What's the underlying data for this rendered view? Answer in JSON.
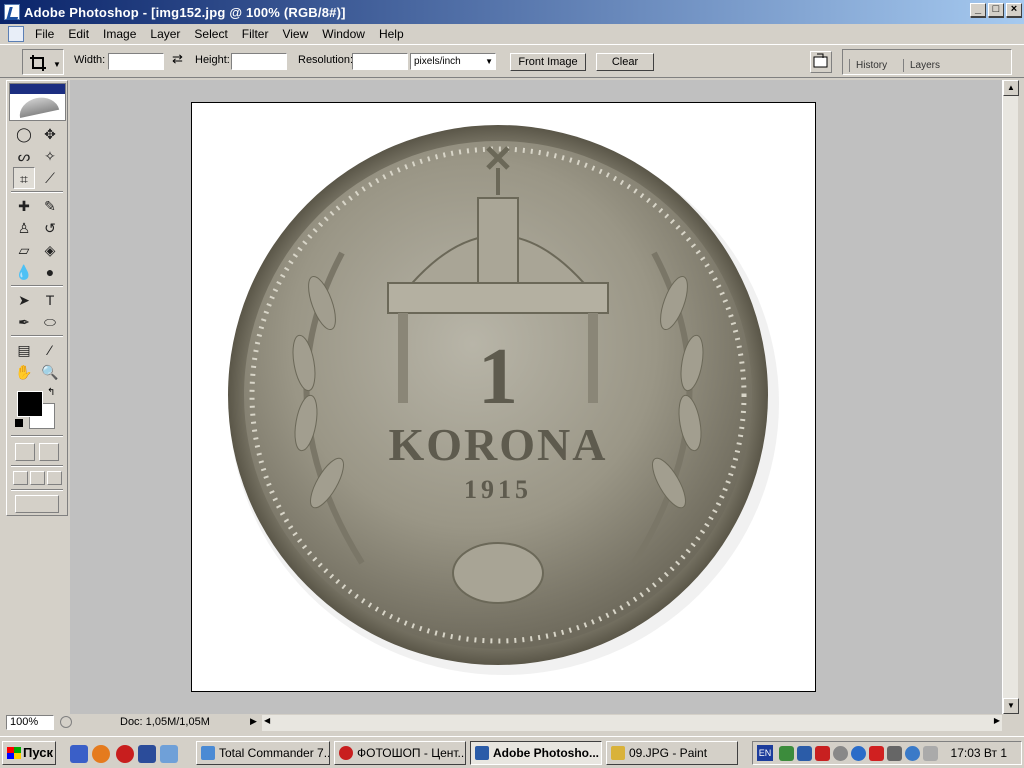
{
  "window": {
    "title": "Adobe Photoshop - [img152.jpg @ 100% (RGB/8#)]",
    "controls": [
      "_",
      "□",
      "×"
    ]
  },
  "menu": [
    "File",
    "Edit",
    "Image",
    "Layer",
    "Select",
    "Filter",
    "View",
    "Window",
    "Help"
  ],
  "options": {
    "width_label": "Width:",
    "width_value": "",
    "height_label": "Height:",
    "height_value": "",
    "resolution_label": "Resolution:",
    "resolution_value": "",
    "units": "pixels/inch",
    "front_image": "Front Image",
    "clear": "Clear"
  },
  "palette_well": {
    "tabs": [
      "History",
      "Layers"
    ]
  },
  "toolbox": {
    "foreground_color": "#000000",
    "background_color": "#ffffff",
    "active_tool": "crop-tool"
  },
  "document": {
    "coin": {
      "denomination": "1",
      "unit": "KORONA",
      "year": "1915"
    }
  },
  "status": {
    "zoom": "100%",
    "doc_info": "Doc: 1,05M/1,05M"
  },
  "taskbar": {
    "start": "Пуск",
    "tasks": [
      {
        "label": "Total Commander 7...",
        "active": false
      },
      {
        "label": "ФОТОШОП - Цент...",
        "active": false
      },
      {
        "label": "Adobe Photosho...",
        "active": true
      },
      {
        "label": "09.JPG - Paint",
        "active": false
      }
    ],
    "lang": "EN",
    "clock": "17:03 Вт 1"
  }
}
